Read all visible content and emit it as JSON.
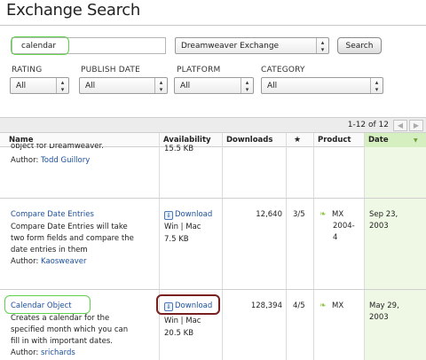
{
  "page": {
    "title": "Exchange Search"
  },
  "search": {
    "value": "calendar",
    "source": "Dreamweaver Exchange",
    "button": "Search"
  },
  "filters": [
    {
      "label": "RATING",
      "value": "All"
    },
    {
      "label": "PUBLISH DATE",
      "value": "All"
    },
    {
      "label": "PLATFORM",
      "value": "All"
    },
    {
      "label": "CATEGORY",
      "value": "All"
    }
  ],
  "results": {
    "count": "1-12 of 12",
    "prev": "◀",
    "next": "▶"
  },
  "columns": {
    "name": "Name",
    "availability": "Availability",
    "downloads": "Downloads",
    "rating_icon": "★",
    "product": "Product",
    "date": "Date",
    "sort_arrow": "▼"
  },
  "rows": [
    {
      "description_tail": "object for Dreamweaver.",
      "author_label": "Author:",
      "author": "Todd Guillory",
      "size": "15.5 KB"
    },
    {
      "name": "Compare Date Entries",
      "description": [
        "Compare Date Entries will take",
        "two form fields and compare the",
        "date entries in them"
      ],
      "author_label": "Author:",
      "author": "Kaosweaver",
      "download": "Download",
      "platform": "Win | Mac",
      "size": "7.5 KB",
      "downloads": "12,640",
      "rating": "3/5",
      "product": [
        "MX",
        "2004-",
        "4"
      ],
      "date": [
        "Sep 23,",
        "2003"
      ]
    },
    {
      "name": "Calendar Object",
      "description": [
        "Creates a calendar for the",
        "specified month which you can",
        "fill in with important dates."
      ],
      "author_label": "Author:",
      "author": "srichards",
      "download": "Download",
      "platform": "Win | Mac",
      "size": "20.5 KB",
      "downloads": "128,394",
      "rating": "4/5",
      "product": [
        "MX"
      ],
      "date": [
        "May 29,",
        "2003"
      ]
    }
  ],
  "icons": {
    "download": "download-arrow-icon",
    "product": "leaf-icon",
    "select_arrow": "updown-arrow-icon"
  },
  "colors": {
    "link": "#1a4f9c",
    "highlight_green": "#5ed24a",
    "highlight_red": "#7a1f1f",
    "date_column": "#eef8e4"
  }
}
